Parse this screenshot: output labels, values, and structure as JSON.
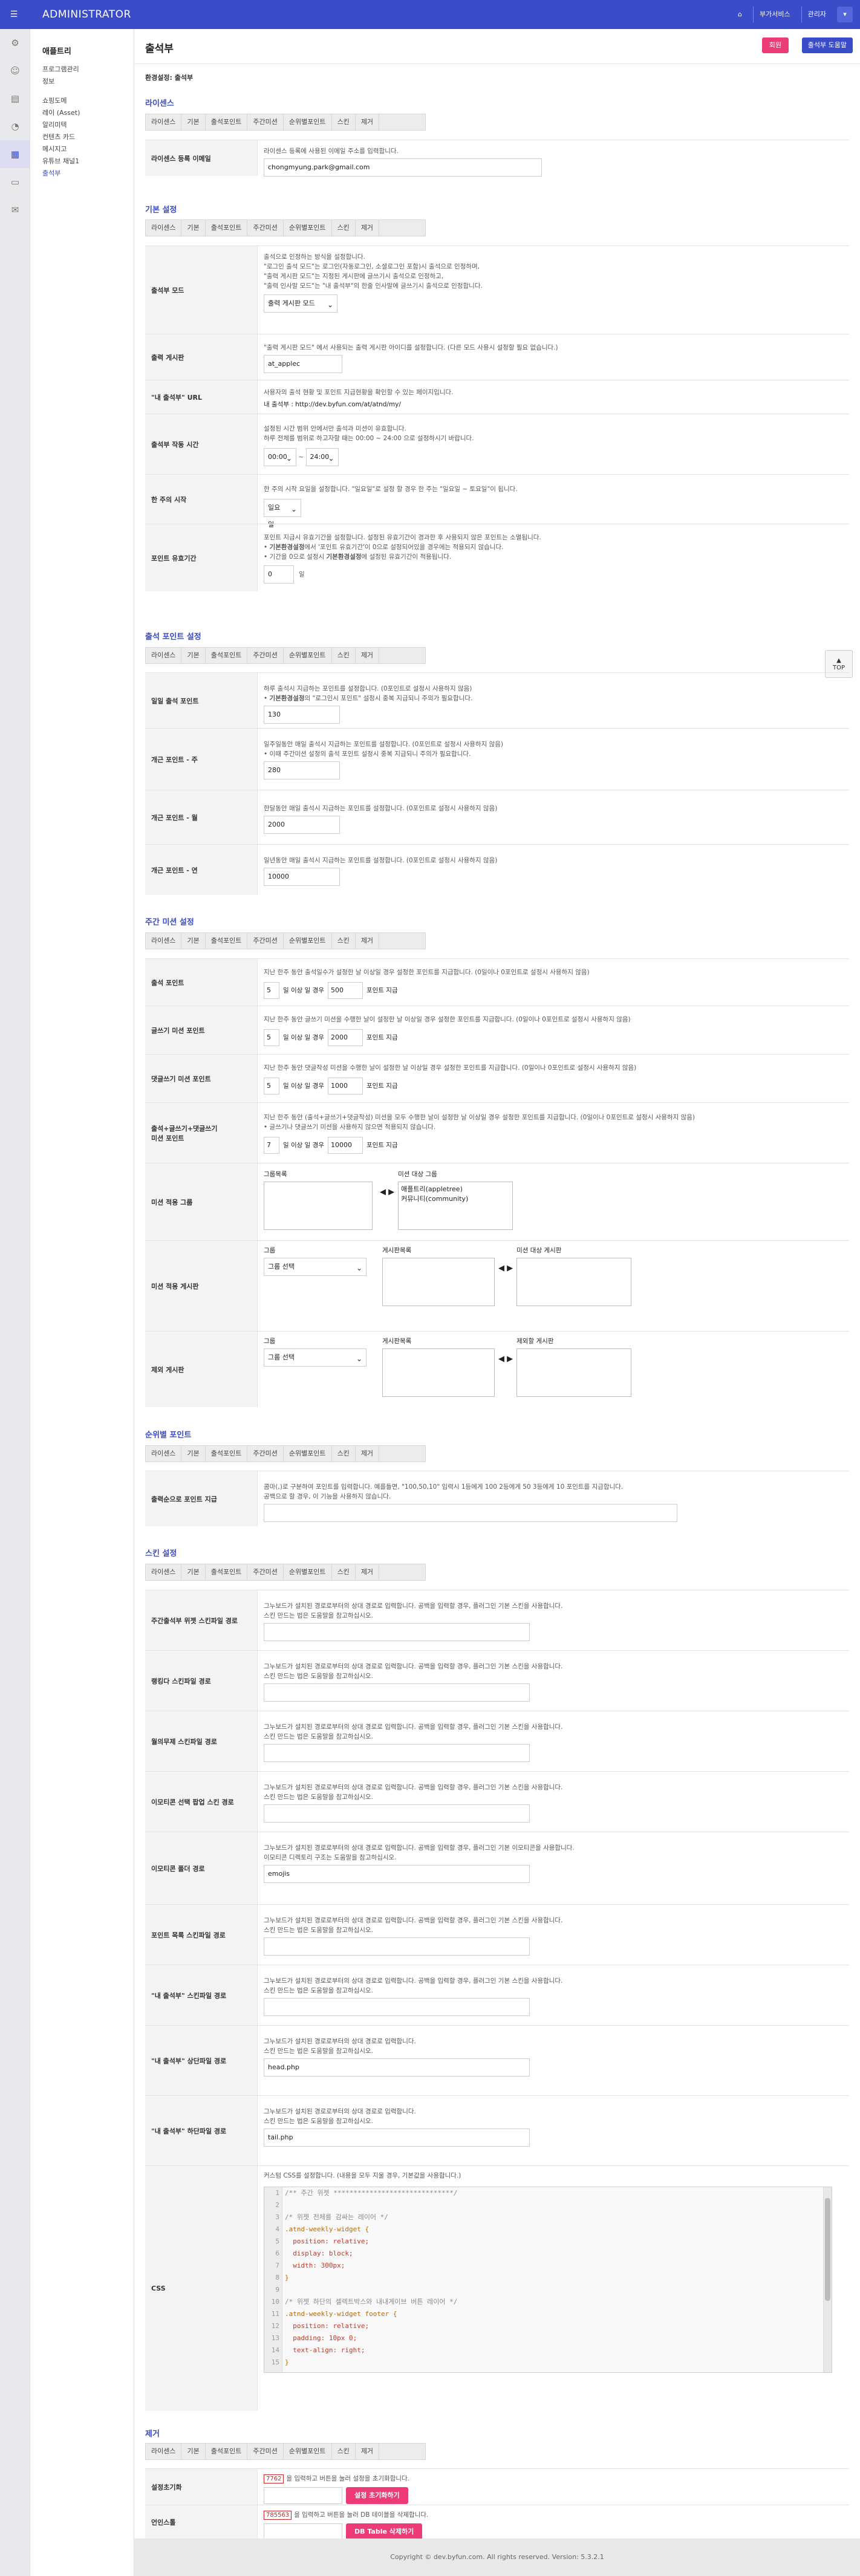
{
  "topbar": {
    "brand": "ADMINISTRATOR",
    "menu_icon": "hamburger-icon",
    "home_icon": "home-icon",
    "links": [
      "부가서비스",
      "관리자"
    ]
  },
  "sidebar": {
    "title": "애플트리",
    "items": [
      "프로그램관리",
      "정보",
      "쇼핑도메",
      "레이 (Asset)",
      "알리미텍",
      "컨텐츠 카드",
      "메시지고",
      "유튜브 채널1",
      "출석부"
    ]
  },
  "page": {
    "title": "출석부",
    "btn_red": "회원",
    "btn_blue": "출석부 도움말",
    "breadcrumb": "환경설정: 출석부",
    "top_label": "TOP"
  },
  "tabs": [
    "라이센스",
    "기본",
    "출석포인트",
    "주간미션",
    "순위별포인트",
    "스킨",
    "제거"
  ],
  "sections": {
    "license": "라이센스",
    "basic": "기본 설정",
    "attend_point": "출석 포인트 설정",
    "weekly": "주간 미션 설정",
    "rank": "순위별 포인트",
    "skin": "스킨 설정",
    "remove": "제거"
  },
  "license": {
    "label": "라이센스 등록 이메일",
    "desc": "라이센스 등록에 사용된 이메일 주소를 입력합니다.",
    "value": "chongmyung.park@gmail.com"
  },
  "basic": {
    "mode_label": "출석부 모드",
    "mode_desc": [
      "출석으로 인정하는 방식을 설정합니다.",
      "\"로그인 출석 모드\"는 로그인(자동로그인, 소셜로그인 포함)시 출석으로 인정하며,",
      "\"출력 게시판 모드\"는 지정된 게시판에 글쓰기시 출석으로 인정하고,",
      "\"출력 인사말 모드\"는 \"내 출석부\"의 한줄 인사말에 글쓰기시 출석으로 인정합니다."
    ],
    "mode_value": "출력 게시판 모드",
    "board_label": "출력 게시판",
    "board_desc": "\"출력 게시판 모드\" 에서 사용되는 출력 게시판 아이디를 설정합니다. (다른 모드 사용시 설정할 필요 없습니다.)",
    "board_value": "at_applec",
    "url_label": "\"내 출석부\" URL",
    "url_desc": "사용자의 출석 현황 및 포인트 지급현황을 확인할 수 있는 페이지입니다.",
    "url_prefix": "내 출석부 :",
    "url_value": "http://dev.byfun.com/at/atnd/my/",
    "time_label": "출석부 작동 시간",
    "time_desc": [
      "설정된 시간 범위 안에서만 출석과 미션이 유효합니다.",
      "하루 전체를 범위로 하고자할 때는 00:00 ~ 24:00 으로 설정하시기 바랍니다."
    ],
    "time_from": "00:00",
    "time_sep": "~",
    "time_to": "24:00",
    "week_label": "한 주의 시작",
    "week_desc": "한 주의 시작 요일을 설정합니다. \"일요일\"로 설정 할 경우 한 주는 \"일요일 ~ 토요일\"이 됩니다.",
    "week_value": "일요일",
    "exp_label": "포인트 유효기간",
    "exp_desc1": "포인트 지급시 유효기간을 설정합니다. 설정된 유효기간이 경과한 후 사용되지 않은 포인트는 소멸됩니다.",
    "exp_desc2a": "• ",
    "exp_desc2b": "기본환경설정",
    "exp_desc2c": "에서 '포인트 유효기간'이 0으로 설정되어있을 경우에는 적용되지 않습니다.",
    "exp_desc3a": "• 기간을 0으로 설정시 ",
    "exp_desc3b": "기본환경설정",
    "exp_desc3c": "에 설정된 유효기간이 적용됩니다.",
    "exp_value": "0",
    "exp_unit": "일"
  },
  "attend": {
    "daily_label": "일일 출석 포인트",
    "daily_desc1": "하루 출석시 지급하는 포인트를 설정합니다. (0포인트로 설정시 사용하지 않음)",
    "daily_desc2a": "• ",
    "daily_desc2b": "기본환경설정",
    "daily_desc2c": "의 \"로그인시 포인트\" 설정시 중복 지급되니 주의가 필요합니다.",
    "daily_value": "130",
    "week_label": "개근 포인트 - 주",
    "week_desc1": "일주일동안 매일 출석시 지급하는 포인트를 설정합니다. (0포인트로 설정시 사용하지 않음)",
    "week_desc2": "• 이때 주간미션 설정의 출석 포인트 설정시 중복 지급되니 주의가 필요합니다.",
    "week_value": "280",
    "month_label": "개근 포인트 - 월",
    "month_desc": "한달동안 매일 출석시 지급하는 포인트를 설정합니다. (0포인트로 설정시 사용하지 않음)",
    "month_value": "2000",
    "year_label": "개근 포인트 - 연",
    "year_desc": "일년동안 매일 출석시 지급하는 포인트를 설정합니다. (0포인트로 설정시 사용하지 않음)",
    "year_value": "10000"
  },
  "weekly": {
    "attend_label": "출석 포인트",
    "attend_desc": "지난 한주 동안 출석일수가 설정한 날 이상일 경우 설정한 포인트를 지급합니다. (0일이나 0포인트로 설정시 사용하지 않음)",
    "attend_days": "5",
    "attend_pts": "500",
    "write_label": "글쓰기 미션 포인트",
    "write_desc": "지난 한주 동안 글쓰기 미션을 수행한 날이 설정한 날 이상일 경우 설정한 포인트를 지급합니다. (0일이나 0포인트로 설정시 사용하지 않음)",
    "write_days": "5",
    "write_pts": "2000",
    "comment_label": "댓글쓰기 미션 포인트",
    "comment_desc": "지난 한주 동안 댓글작성 미션을 수행한 날이 설정한 날 이상일 경우 설정한 포인트를 지급합니다. (0일이나 0포인트로 설정시 사용하지 않음)",
    "comment_days": "5",
    "comment_pts": "1000",
    "combo_label1": "출석+글쓰기+댓글쓰기",
    "combo_label2": "미션 포인트",
    "combo_desc1": "지난 한주 동안 (출석+글쓰기+댓글작성) 미션을 모두 수행한 날이 설정한 날 이상일 경우 설정한 포인트를 지급합니다. (0일이나 0포인트로 설정시 사용하지 않음)",
    "combo_desc2": "• 글쓰기나 댓글쓰기 미션을 사용하지 않으면 적용되지 않습니다.",
    "combo_days": "7",
    "combo_pts": "10000",
    "days_text": "일 이상 일 경우",
    "pts_text": "포인트 지급",
    "group_label": "미션 적용 그룹",
    "group_list_label": "그룹목록",
    "group_target_label": "미션 대상 그룹",
    "group_targets": [
      "애플트리(appletree)",
      "커뮤니티(community)"
    ],
    "board_label": "미션 적용 게시판",
    "except_label": "제외 게시판",
    "grp_label": "그룹",
    "grp_select": "그룹 선택",
    "board_list_label": "게시판목록",
    "mission_board_label": "미션 대상 게시판",
    "except_board_label": "제외할 게시판"
  },
  "rank": {
    "label": "출력순으로 포인트 지급",
    "desc1": "콤마(,)로 구분하여 포인트를 입력합니다. 예를들면, \"100,50,10\" 입력시 1등에게 100 2등에게 50 3등에게 10 포인트를 지급합니다.",
    "desc2": "공백으로 할 경우, 이 기능을 사용하지 않습니다.",
    "value": ""
  },
  "skin": {
    "desc_common": "그누보드가 설치된 경로로부터의 상대 경로로 입력합니다. 공백을 입력할 경우, 플러그인 기본 스킨을 사용합니다.",
    "desc_common2": "스킨 만드는 법은 도움말을 참고하십시오.",
    "rows": [
      {
        "label": "주간출석부 위젯 스킨파일 경로",
        "value": ""
      },
      {
        "label": "랭킹다 스킨파일 경로",
        "value": ""
      },
      {
        "label": "월의무제 스킨파일 경로",
        "value": ""
      },
      {
        "label": "이모티콘 선택 팝업 스킨 경로",
        "value": ""
      },
      {
        "label": "이모티콘 폴더 경로",
        "value": "emojis"
      },
      {
        "label": "포인트 목록 스킨파일 경로",
        "value": ""
      },
      {
        "label": "\"내 출석부\" 스킨파일 경로",
        "value": ""
      },
      {
        "label": "\"내 출석부\" 상단파일 경로",
        "value": "head.php"
      },
      {
        "label": "\"내 출석부\" 하단파일 경로",
        "value": "tail.php"
      }
    ],
    "emoji_desc": "그누보드가 설치된 경로로부터의 상대 경로로 입력합니다. 공백을 입력할 경우, 플러그인 기본 이모티콘을 사용합니다.",
    "emoji_desc2": "이모티콘 디렉토리 구조는 도움말을 참고하십시오.",
    "ht_desc": "그누보드가 설치된 경로로부터의 상대 경로로 입력합니다.",
    "css_label": "CSS",
    "css_desc": "커스텀 CSS를 설정합니다. (내용을 모두 지울 경우, 기본값을 사용합니다.)",
    "css_lines": [
      "/** 주간 위젯 ******************************/",
      "",
      "/* 위젯 전체를 감싸는 레이어 */",
      ".atnd-weekly-widget {",
      "  position: relative;",
      "  display: block;",
      "  width: 300px;",
      "}",
      "",
      "/* 위젯 하단의 셀렉트박스와 내내계이브 버튼 레이어 */",
      ".atnd-weekly-widget footer {",
      "  position: relative;",
      "  padding: 10px 0;",
      "  text-align: right;",
      "}"
    ]
  },
  "remove": {
    "reset_label": "설정초기화",
    "reset_code": "7762",
    "reset_desc": "을 입력하고 버튼을 눌러 설정을 초기화합니다.",
    "reset_btn": "설정 초기화하기",
    "uninst_label": "언인스톨",
    "uninst_code": "785563",
    "uninst_desc": "을 입력하고 버튼을 눌러 DB 테이블을 삭제합니다.",
    "uninst_btn": "DB Table 삭제하기"
  },
  "footer": "Copyright © dev.byfun.com. All rights reserved. Version: 5.3.2.1",
  "colors": {
    "primary": "#3a4cc8",
    "accent": "#ec3b77"
  }
}
